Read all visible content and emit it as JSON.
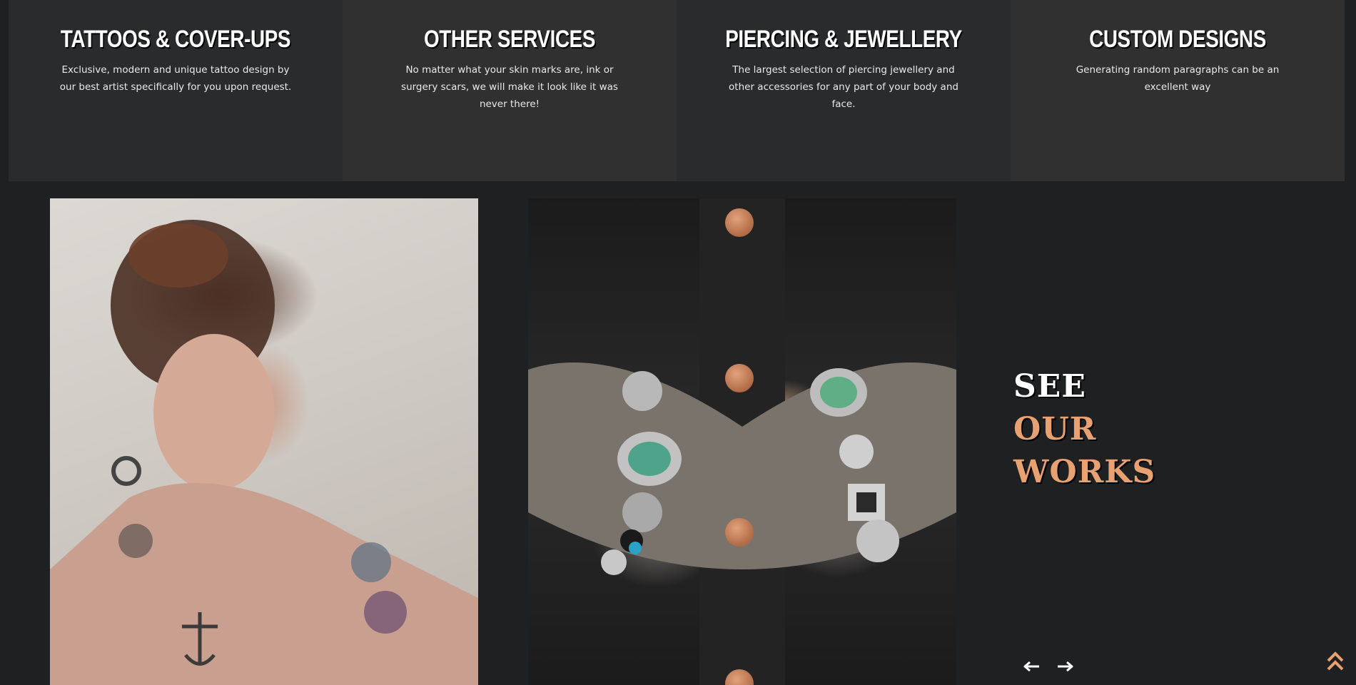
{
  "services": [
    {
      "title": "TATTOOS & COVER-UPS",
      "description": "Exclusive, modern and unique tattoo design by our best artist specifically for you upon request."
    },
    {
      "title": "OTHER SERVICES",
      "description": "No matter what your skin marks are, ink or surgery scars, we will make it look like it was never there!"
    },
    {
      "title": "PIERCING & JEWELLERY",
      "description": "The largest selection of piercing jewellery and other accessories for any part of your body and face."
    },
    {
      "title": "CUSTOM DESIGNS",
      "description": "Generating random paragraphs can be an excellent way"
    }
  ],
  "gallery": {
    "heading_line1": "SEE",
    "heading_line2": "OUR",
    "heading_line3": "WORKS"
  },
  "colors": {
    "accent": "#e8a171",
    "background": "#1f2022",
    "card_dark": "#2a2b2d",
    "card_light": "#303031"
  },
  "icons": {
    "prev": "arrow-left-icon",
    "next": "arrow-right-icon",
    "top": "double-chevron-up-icon"
  }
}
